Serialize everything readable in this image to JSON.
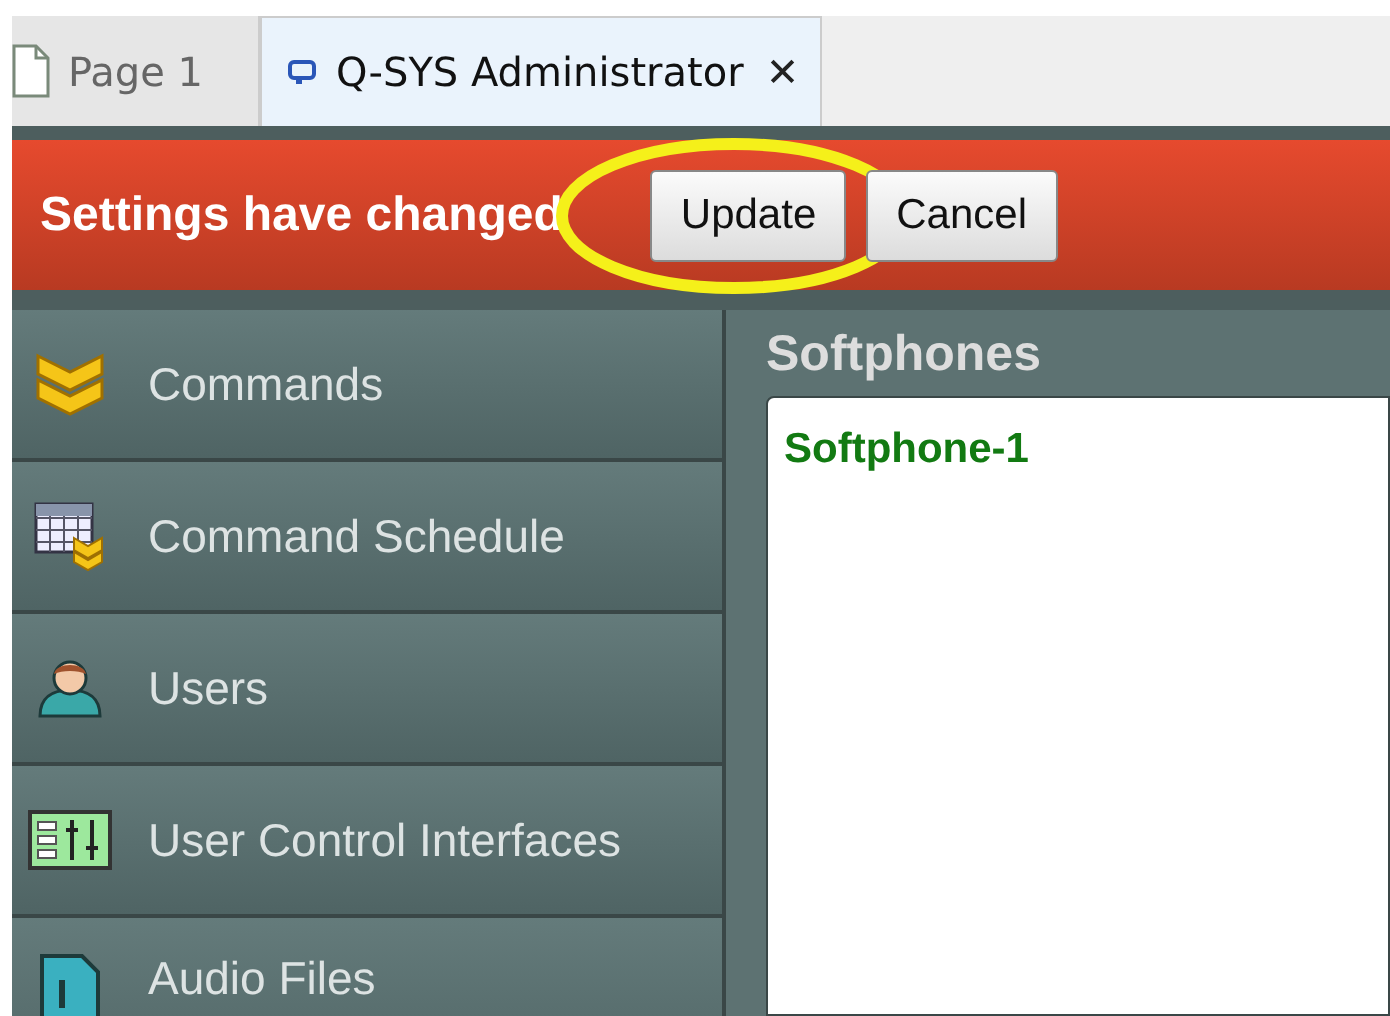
{
  "tabs": [
    {
      "label": "Page 1",
      "selected": false,
      "kind": "page"
    },
    {
      "label": "Q-SYS Administrator",
      "selected": true,
      "kind": "app",
      "close": "✕"
    }
  ],
  "banner": {
    "message": "Settings have changed",
    "buttons": [
      {
        "label": "Update",
        "highlighted": true
      },
      {
        "label": "Cancel",
        "highlighted": false
      }
    ]
  },
  "sidebar": {
    "items": [
      {
        "label": "Commands",
        "kind": "commands"
      },
      {
        "label": "Command Schedule",
        "kind": "schedule"
      },
      {
        "label": "Users",
        "kind": "users"
      },
      {
        "label": "User Control Interfaces",
        "kind": "uci"
      },
      {
        "label": "Audio Files",
        "kind": "audio"
      }
    ]
  },
  "panel": {
    "title": "Softphones",
    "items": [
      "Softphone-1"
    ]
  }
}
